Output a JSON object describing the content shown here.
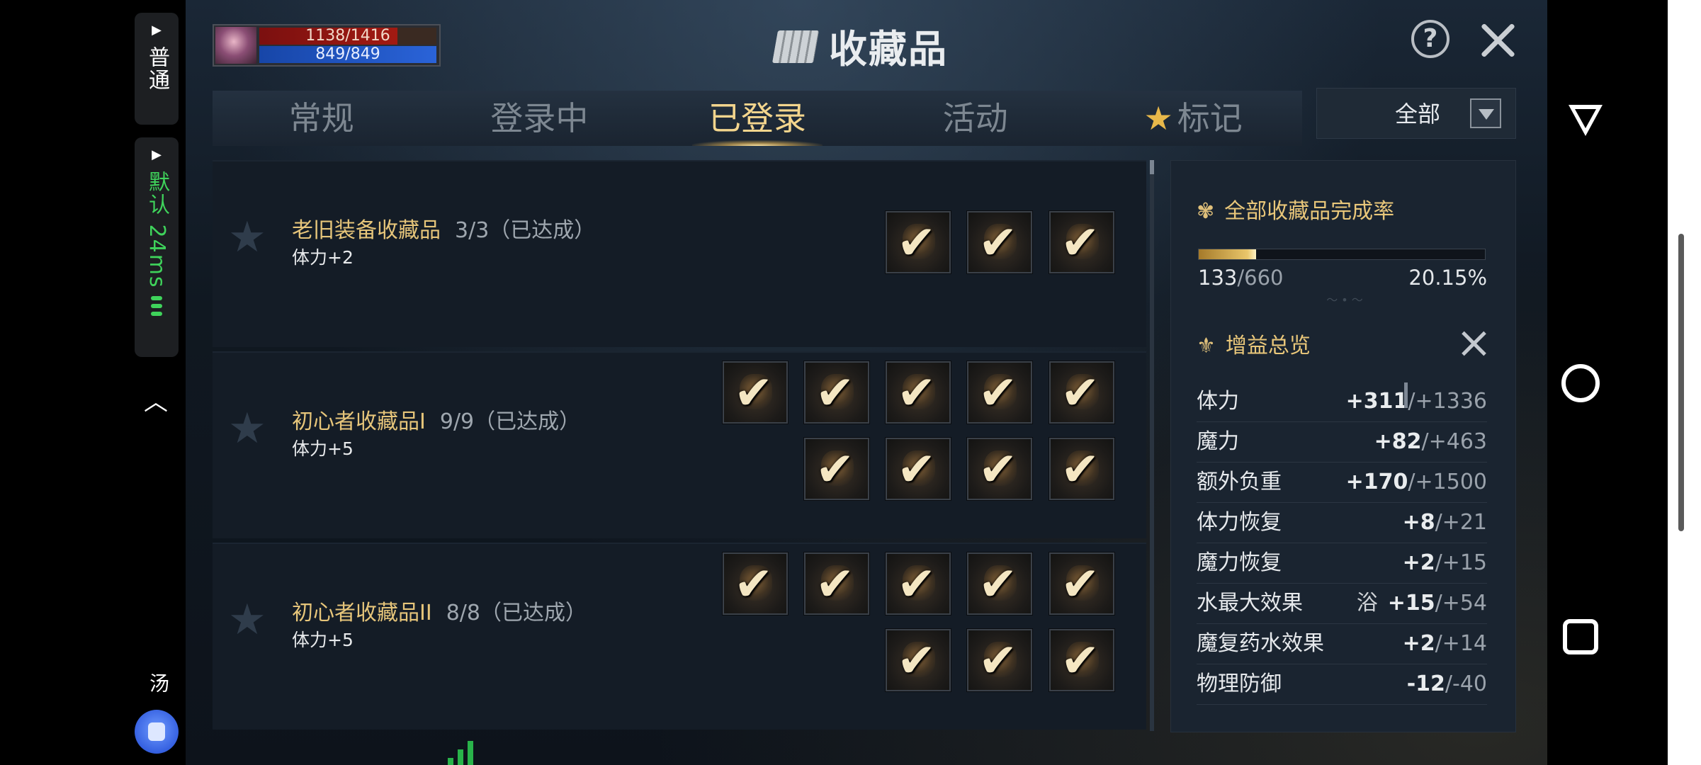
{
  "sidebar": {
    "mode_label": "普通",
    "network_label": "默认 24ms",
    "bottom_label": "汤"
  },
  "hud": {
    "hp": "1138/1416",
    "mp": "849/849"
  },
  "header": {
    "title": "收藏品"
  },
  "tabs": [
    {
      "label": "常规"
    },
    {
      "label": "登录中"
    },
    {
      "label": "已登录"
    },
    {
      "label": "活动"
    },
    {
      "label": "标记"
    }
  ],
  "filter": {
    "selected": "全部"
  },
  "collections": [
    {
      "name": "老旧装备收藏品",
      "progress": "3/3（已达成）",
      "bonus": "体力+2"
    },
    {
      "name": "初心者收藏品I",
      "progress": "9/9（已达成）",
      "bonus": "体力+5"
    },
    {
      "name": "初心者收藏品II",
      "progress": "8/8（已达成）",
      "bonus": "体力+5"
    }
  ],
  "completion": {
    "title": "全部收藏品完成率",
    "current": "133",
    "total": "/660",
    "percent": "20.15%",
    "fraction": 0.2015
  },
  "buffs": {
    "title": "增益总览",
    "items": [
      {
        "name": "体力",
        "value": "+311",
        "max": "/+1336"
      },
      {
        "name": "魔力",
        "value": "+82",
        "max": "/+463"
      },
      {
        "name": "额外负重",
        "value": "+170",
        "max": "/+1500"
      },
      {
        "name": "体力恢复",
        "value": "+8",
        "max": "/+21"
      },
      {
        "name": "魔力恢复",
        "value": "+2",
        "max": "/+15"
      },
      {
        "name": "水最大效果",
        "extra": "浴",
        "value": "+15",
        "max": "/+54"
      },
      {
        "name": "魔复药水效果",
        "value": "+2",
        "max": "/+14"
      },
      {
        "name": "物理防御",
        "value": "-12",
        "max": "/-40"
      }
    ]
  },
  "colors": {
    "gold": "#e6c57a",
    "active_tab": "#f3d58d",
    "hp": "#a11a12",
    "mp": "#2a63d8"
  }
}
